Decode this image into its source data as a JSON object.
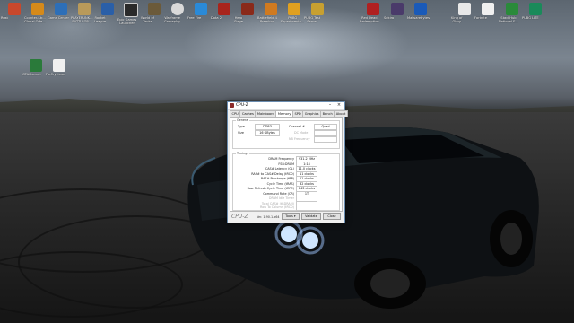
{
  "desktop": {
    "icons": [
      {
        "name": "rust-icon",
        "label": "Rust",
        "color": "#c8482c"
      },
      {
        "name": "counter-strike-icon",
        "label": "Counter-Str...\nGlobal Offe...",
        "color": "#d68a1a"
      },
      {
        "name": "game-center-icon",
        "label": "Game Center",
        "color": "#2d6fb8"
      },
      {
        "name": "playerunknown-icon",
        "label": "PLAYERUNK...\nBATTLEGR...",
        "color": "#b99a5a"
      },
      {
        "name": "rocket-league-icon",
        "label": "Rocket\nLeague",
        "color": "#2a5fa8"
      },
      {
        "name": "epic-games-icon",
        "label": "Epic Games\nLauncher",
        "color": "#2a2a2a"
      },
      {
        "name": "world-of-tanks-icon",
        "label": "World of\nTanks",
        "color": "#6b5a3a"
      },
      {
        "name": "warframe-icon",
        "label": "Warframe\nGameplay",
        "color": "#d9d9d9"
      },
      {
        "name": "free-fire-icon",
        "label": "Free Fire",
        "color": "#2a8ad8"
      },
      {
        "name": "dota2-icon",
        "label": "Dota 2",
        "color": "#a8241c"
      },
      {
        "name": "hero-siege-icon",
        "label": "Hero\nSiege",
        "color": "#8a2a1a"
      },
      {
        "name": "battlefield-icon",
        "label": "Battlefield 4\nPremium",
        "color": "#d07a20"
      },
      {
        "name": "pubg-test-icon",
        "label": "PUBG\nExperimenta...",
        "color": "#e0a020"
      },
      {
        "name": "pubg-lite-icon",
        "label": "PUBG Test\nServer",
        "color": "#c8a030"
      },
      {
        "name": "red-dead-icon",
        "label": "Red Dead\nRedemption",
        "color": "#b02020"
      },
      {
        "name": "sekiro-icon",
        "label": "Sekiro",
        "color": "#4a3a6a"
      },
      {
        "name": "malwarebytes-icon",
        "label": "Malwarebytes",
        "color": "#1a5ab8"
      },
      {
        "name": "king-of-glory-icon",
        "label": "King of\nGlory",
        "color": "#e8e8e8"
      },
      {
        "name": "fortnite-icon",
        "label": "Fortnite",
        "color": "#f0f0f0"
      },
      {
        "name": "stackhub-icon",
        "label": "StackHub\nNational E...",
        "color": "#2a8a3a"
      },
      {
        "name": "pubg-lite2-icon",
        "label": "PUBG LITE",
        "color": "#1a8a5a"
      },
      {
        "name": "gtav-icon",
        "label": "GTAVLaun...",
        "color": "#2a7a3a"
      },
      {
        "name": "farcry5-icon",
        "label": "FarCry5.exe",
        "color": "#f0f0f0"
      }
    ]
  },
  "cpuz": {
    "title": "CPU-Z",
    "tabs": [
      "CPU",
      "Caches",
      "Mainboard",
      "Memory",
      "SPD",
      "Graphics",
      "Bench",
      "About"
    ],
    "general": {
      "group_label": "General",
      "type_label": "Type",
      "type_value": "DDR3",
      "size_label": "Size",
      "size_value": "16 GBytes",
      "channel_label": "Channel #",
      "channel_value": "Quad",
      "dc_mode_label": "DC Mode",
      "nb_freq_label": "NB Frequency"
    },
    "timings": {
      "group_label": "Timings",
      "rows": [
        {
          "label": "DRAM Frequency",
          "value": "931.2 MHz"
        },
        {
          "label": "FSB:DRAM",
          "value": "1:14"
        },
        {
          "label": "CAS# Latency (CL)",
          "value": "11.0 clocks"
        },
        {
          "label": "RAS# to CAS# Delay (tRCD)",
          "value": "11 clocks"
        },
        {
          "label": "RAS# Precharge (tRP)",
          "value": "11 clocks"
        },
        {
          "label": "Cycle Time (tRAS)",
          "value": "32 clocks"
        },
        {
          "label": "Row Refresh Cycle Time (tRFC)",
          "value": "243 clocks"
        },
        {
          "label": "Command Rate (CR)",
          "value": "1T"
        },
        {
          "label": "DRAM Idle Timer",
          "value": ""
        },
        {
          "label": "Total CAS# (tRDRAM)",
          "value": ""
        },
        {
          "label": "Row To Column (tRCD)",
          "value": ""
        }
      ]
    },
    "footer": {
      "brand": "CPU-Z",
      "version": "Ver. 1.90.1.x64",
      "tools_label": "Tools",
      "validate_label": "Validate",
      "close_label": "Close"
    }
  }
}
